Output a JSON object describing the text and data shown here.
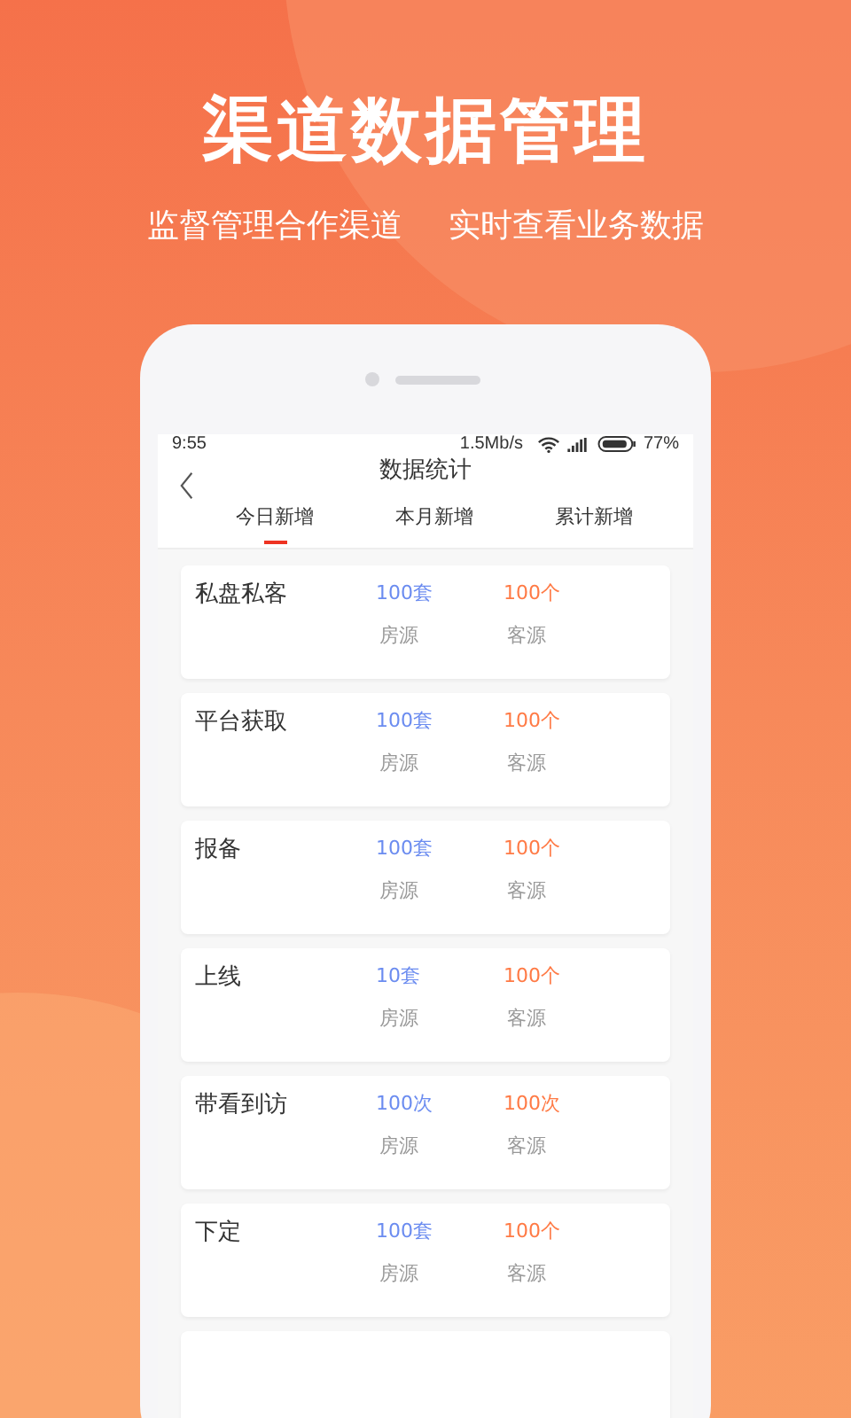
{
  "headline": "渠道数据管理",
  "subtitles": [
    "监督管理合作渠道",
    "实时查看业务数据"
  ],
  "status_bar": {
    "time": "9:55",
    "speed": "1.5Mb/s",
    "battery": "77%"
  },
  "nav": {
    "title": "数据统计"
  },
  "tabs": [
    {
      "label": "今日新增",
      "selected": true
    },
    {
      "label": "本月新增",
      "selected": false
    },
    {
      "label": "累计新增",
      "selected": false
    }
  ],
  "rows": [
    {
      "title": "私盘私客",
      "listings_value": "100套",
      "listings_label": "房源",
      "clients_value": "100个",
      "clients_label": "客源"
    },
    {
      "title": "平台获取",
      "listings_value": "100套",
      "listings_label": "房源",
      "clients_value": "100个",
      "clients_label": "客源"
    },
    {
      "title": "报备",
      "listings_value": "100套",
      "listings_label": "房源",
      "clients_value": "100个",
      "clients_label": "客源"
    },
    {
      "title": "上线",
      "listings_value": "10套",
      "listings_label": "房源",
      "clients_value": "100个",
      "clients_label": "客源"
    },
    {
      "title": "带看到访",
      "listings_value": "100次",
      "listings_label": "房源",
      "clients_value": "100次",
      "clients_label": "客源"
    },
    {
      "title": "下定",
      "listings_value": "100套",
      "listings_label": "房源",
      "clients_value": "100个",
      "clients_label": "客源"
    }
  ]
}
